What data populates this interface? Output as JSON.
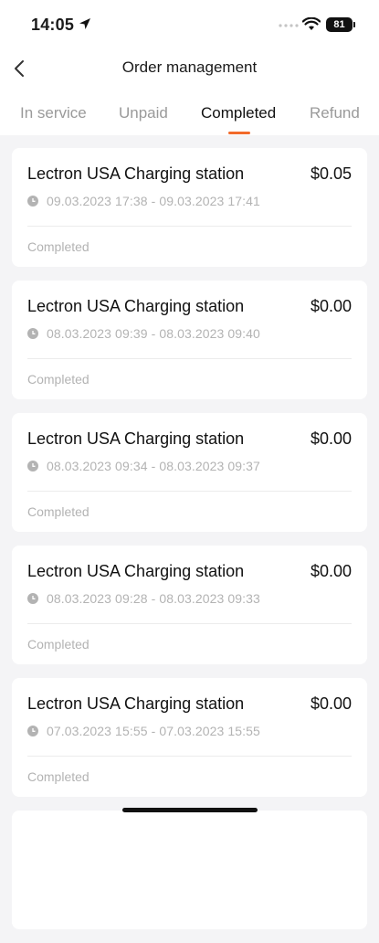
{
  "status_bar": {
    "time": "14:05",
    "battery": "81"
  },
  "header": {
    "title": "Order management"
  },
  "tabs": [
    {
      "label": "In service"
    },
    {
      "label": "Unpaid"
    },
    {
      "label": "Completed"
    },
    {
      "label": "Refund"
    }
  ],
  "active_tab": "Completed",
  "colors": {
    "accent": "#f26a2a",
    "muted_text": "#b3b3b3",
    "background": "#f4f4f6"
  },
  "orders": [
    {
      "station": "Lectron USA Charging station",
      "amount": "$0.05",
      "period": "09.03.2023 17:38 - 09.03.2023 17:41",
      "status": "Completed"
    },
    {
      "station": "Lectron USA Charging station",
      "amount": "$0.00",
      "period": "08.03.2023 09:39 - 08.03.2023 09:40",
      "status": "Completed"
    },
    {
      "station": "Lectron USA Charging station",
      "amount": "$0.00",
      "period": "08.03.2023 09:34 - 08.03.2023 09:37",
      "status": "Completed"
    },
    {
      "station": "Lectron USA Charging station",
      "amount": "$0.00",
      "period": "08.03.2023 09:28 - 08.03.2023 09:33",
      "status": "Completed"
    },
    {
      "station": "Lectron USA Charging station",
      "amount": "$0.00",
      "period": "07.03.2023 15:55 - 07.03.2023 15:55",
      "status": "Completed"
    }
  ]
}
